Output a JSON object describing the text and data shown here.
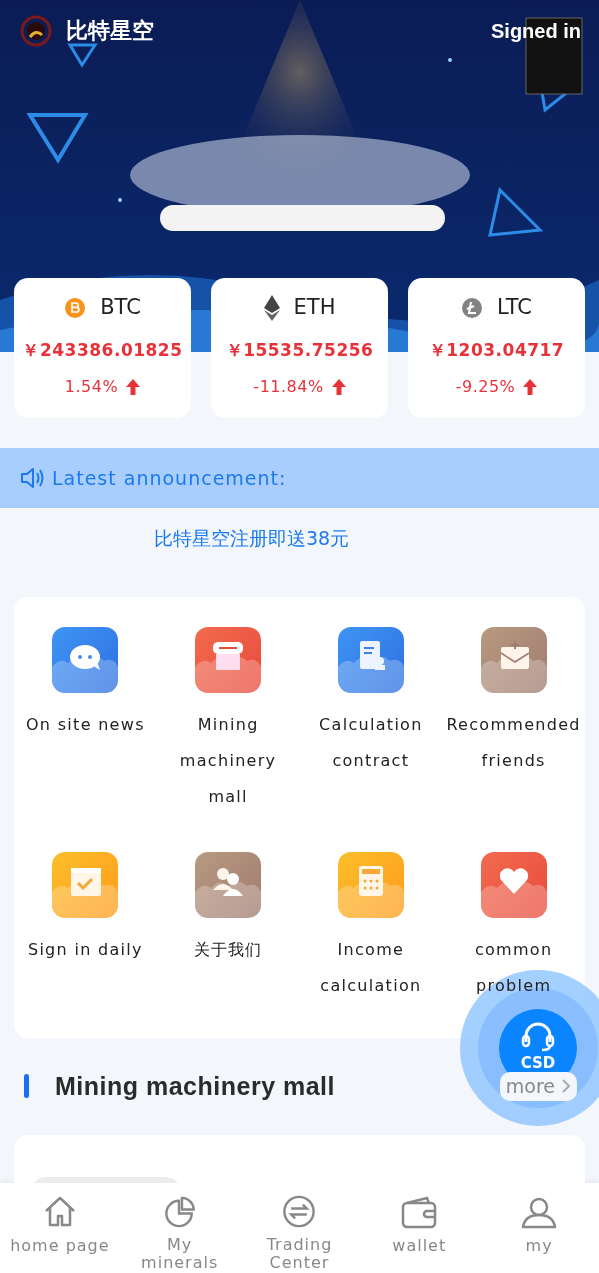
{
  "header": {
    "title": "比特星空",
    "signin": "Signed in"
  },
  "coins": [
    {
      "kind": "btc",
      "symbol": "BTC",
      "price": "￥243386.01825",
      "change": "1.54%"
    },
    {
      "kind": "eth",
      "symbol": "ETH",
      "price": "￥15535.75256",
      "change": "-11.84%"
    },
    {
      "kind": "ltc",
      "symbol": "LTC",
      "price": "￥1203.04717",
      "change": "-9.25%"
    }
  ],
  "announcement": {
    "label": "Latest announcement:",
    "message": "比特星空注册即送38元"
  },
  "shortcuts": [
    {
      "kind": "chat",
      "label": "On site news"
    },
    {
      "kind": "shop",
      "label": "Mining machinery mall"
    },
    {
      "kind": "contract",
      "label": "Calculation contract"
    },
    {
      "kind": "mail",
      "label": "Recommended friends"
    },
    {
      "kind": "calendar",
      "label": "Sign in daily"
    },
    {
      "kind": "people",
      "label": "关于我们"
    },
    {
      "kind": "calculator",
      "label": "Income calculation"
    },
    {
      "kind": "heart",
      "label": "common problem"
    }
  ],
  "section": {
    "title": "Mining machinery mall",
    "more": "more"
  },
  "support": {
    "label": "CSD"
  },
  "tabs": [
    {
      "kind": "home",
      "label": "home page",
      "selected": false
    },
    {
      "kind": "pie",
      "label": "My minerals",
      "selected": false
    },
    {
      "kind": "exchange",
      "label": "Trading Center",
      "selected": false
    },
    {
      "kind": "wallet",
      "label": "wallet",
      "selected": false
    },
    {
      "kind": "user",
      "label": "my",
      "selected": false
    }
  ]
}
